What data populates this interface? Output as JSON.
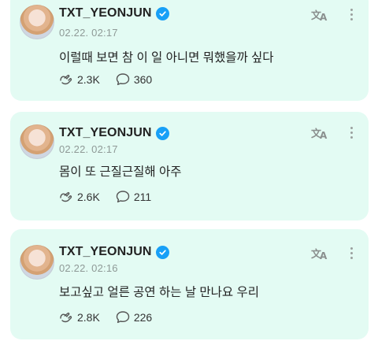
{
  "posts": [
    {
      "author": "TXT_YEONJUN",
      "date": "02.22. 02:17",
      "text": "이럴때 보면 참 이 일 아니면 뭐했을까 싶다",
      "likes": "2.3K",
      "comments": "360"
    },
    {
      "author": "TXT_YEONJUN",
      "date": "02.22. 02:17",
      "text": "몸이 또 근질근질해 아주",
      "likes": "2.6K",
      "comments": "211"
    },
    {
      "author": "TXT_YEONJUN",
      "date": "02.22. 02:16",
      "text": "보고싶고 얼른 공연 하는 날 만나요 우리",
      "likes": "2.8K",
      "comments": "226"
    }
  ],
  "icons": {
    "verified": "verified-badge-icon",
    "translate": "translate-icon",
    "more": "more-vertical-icon",
    "like": "like-hands-icon",
    "comment": "comment-bubble-icon"
  },
  "colors": {
    "card_background": "#e3fbf3",
    "verified_blue": "#18a0f7",
    "date_gray": "#8f9a97"
  }
}
